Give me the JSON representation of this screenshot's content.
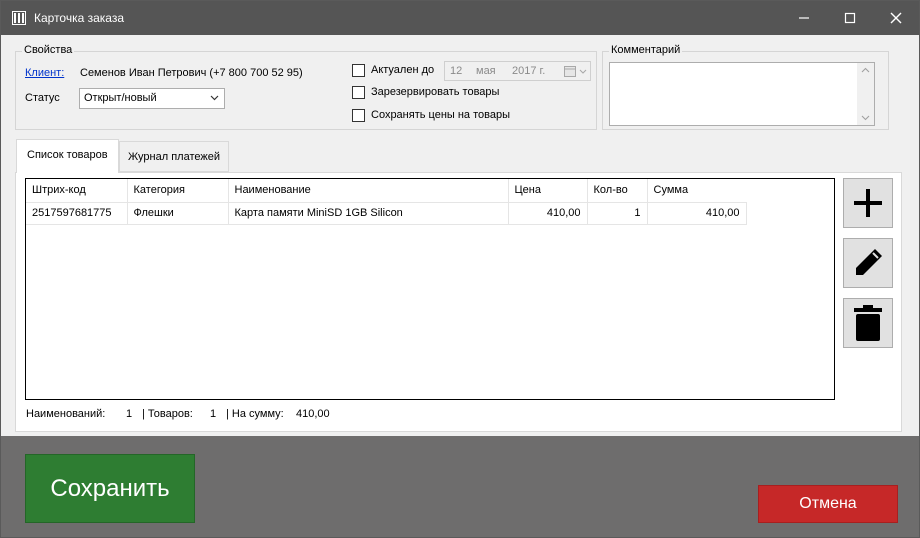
{
  "window": {
    "title": "Карточка заказа"
  },
  "properties": {
    "legend": "Свойства",
    "client_label": "Клиент:",
    "client_value": "Семенов Иван Петрович (+7 800 700 52 95)",
    "status_label": "Статус",
    "status_value": "Открыт/новый"
  },
  "options": {
    "actual_until_label": "Актуален до",
    "actual_until_checked": false,
    "date_day": "12",
    "date_month": "мая",
    "date_year": "2017 г.",
    "reserve_label": "Зарезервировать товары",
    "reserve_checked": false,
    "keep_prices_label": "Сохранять цены на товары",
    "keep_prices_checked": false
  },
  "comment": {
    "legend": "Комментарий",
    "value": ""
  },
  "tabs": [
    {
      "label": "Список товаров",
      "active": true
    },
    {
      "label": "Журнал платежей",
      "active": false
    }
  ],
  "grid": {
    "columns": [
      "Штрих-код",
      "Категория",
      "Наименование",
      "Цена",
      "Кол-во",
      "Сумма"
    ],
    "rows": [
      [
        "2517597681775",
        "Флешки",
        "Карта памяти MiniSD 1GB Silicon",
        "410,00",
        "1",
        "410,00"
      ]
    ]
  },
  "side_buttons": [
    {
      "icon": "plus-icon"
    },
    {
      "icon": "pencil-icon"
    },
    {
      "icon": "trash-icon"
    }
  ],
  "summary": {
    "items_label": "Наименований:",
    "items_value": "1",
    "goods_label": "| Товаров:",
    "goods_value": "1",
    "total_label": "| На сумму:",
    "total_value": "410,00"
  },
  "actions": {
    "save_label": "Сохранить",
    "cancel_label": "Отмена"
  },
  "colors": {
    "titlebar": "#555555",
    "save": "#2e7d32",
    "cancel": "#c62828",
    "link": "#0033cc"
  }
}
